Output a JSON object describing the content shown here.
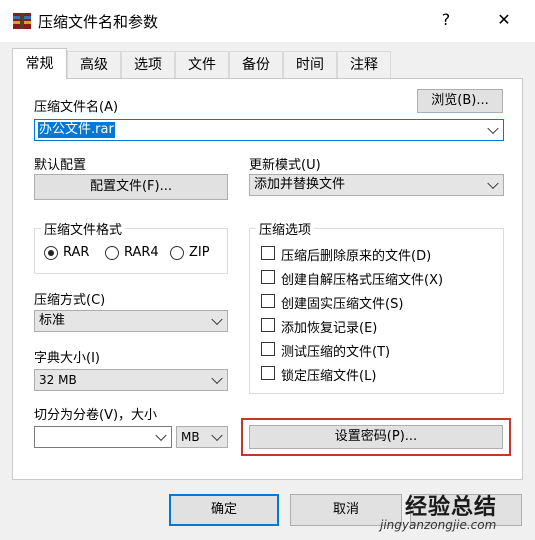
{
  "window": {
    "title": "压缩文件名和参数",
    "help_glyph": "?",
    "close_glyph": "✕"
  },
  "tabs": [
    "常规",
    "高级",
    "选项",
    "文件",
    "备份",
    "时间",
    "注释"
  ],
  "general": {
    "archive_name_label": "压缩文件名(A)",
    "browse_label": "浏览(B)...",
    "archive_name_value": "办公文件.rar",
    "default_profile_label": "默认配置",
    "profiles_button": "配置文件(F)...",
    "update_mode_label": "更新模式(U)",
    "update_mode_value": "添加并替换文件",
    "format_group": {
      "title": "压缩文件格式",
      "options": [
        "RAR",
        "RAR4",
        "ZIP"
      ],
      "selected": "RAR"
    },
    "method_label": "压缩方式(C)",
    "method_value": "标准",
    "dict_label": "字典大小(I)",
    "dict_value": "32 MB",
    "split_label": "切分为分卷(V)，大小",
    "split_value": "",
    "split_unit": "MB",
    "options_group": {
      "title": "压缩选项",
      "items": [
        {
          "label": "压缩后删除原来的文件(D)",
          "checked": false
        },
        {
          "label": "创建自解压格式压缩文件(X)",
          "checked": false
        },
        {
          "label": "创建固实压缩文件(S)",
          "checked": false
        },
        {
          "label": "添加恢复记录(E)",
          "checked": false
        },
        {
          "label": "测试压缩的文件(T)",
          "checked": false
        },
        {
          "label": "锁定压缩文件(L)",
          "checked": false
        }
      ]
    },
    "set_password_button": "设置密码(P)..."
  },
  "footer": {
    "ok_label": "确定",
    "cancel_label": "取消"
  },
  "watermark": {
    "line1": "经验总结",
    "line2": "jingyanzongjie.com"
  },
  "colors": {
    "highlight": "#c0392b",
    "selection": "#0078d7",
    "focus": "#0078d7"
  }
}
